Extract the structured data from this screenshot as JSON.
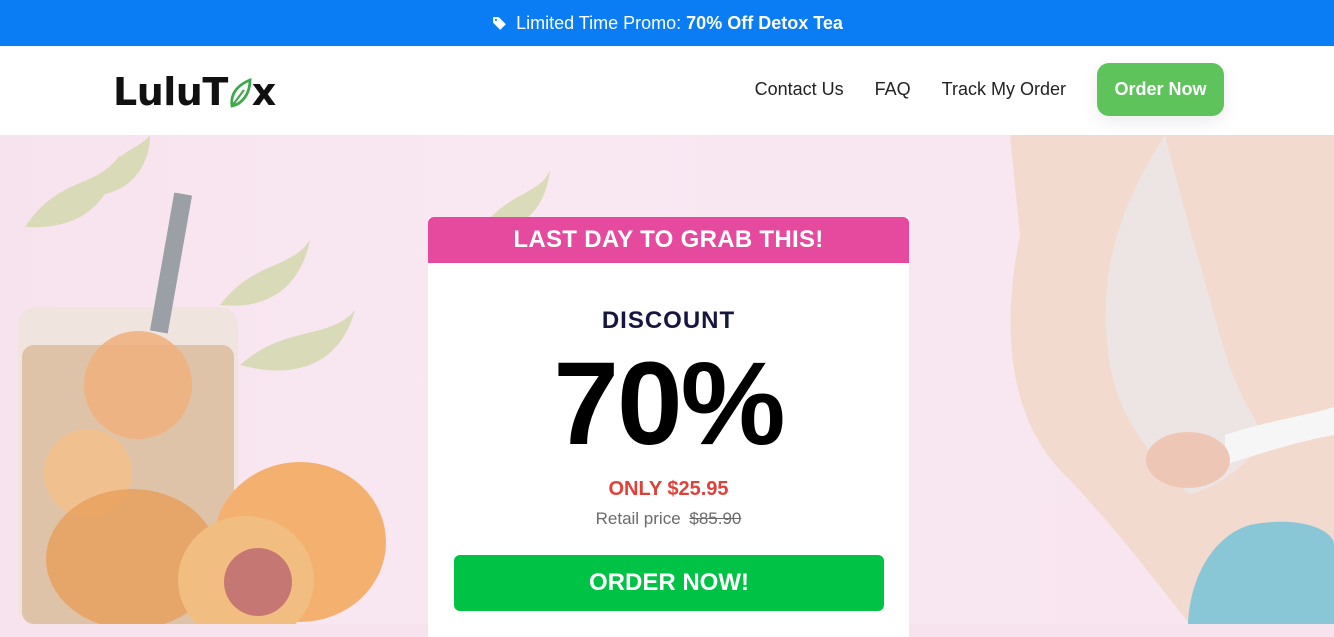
{
  "promo": {
    "text": "Limited Time Promo:",
    "highlight": "70% Off Detox Tea",
    "icon": "tag-icon"
  },
  "brand": {
    "logo_left": "LuluT",
    "logo_right": "x",
    "leaf_icon": "leaf-icon"
  },
  "nav": {
    "links": [
      "Contact Us",
      "FAQ",
      "Track My Order"
    ],
    "cta": "Order Now"
  },
  "card": {
    "headline": "LAST DAY TO GRAB THIS!",
    "label": "DISCOUNT",
    "value": "70%",
    "price_now": "ONLY $25.95",
    "retail_label": "Retail price",
    "retail_value": "$85.90",
    "cta": "ORDER NOW!"
  },
  "colors": {
    "promo_bg": "#0a7cf4",
    "nav_cta": "#5fc35c",
    "card_head": "#e64a9e",
    "price_now": "#e0403a",
    "card_cta": "#00c244"
  }
}
